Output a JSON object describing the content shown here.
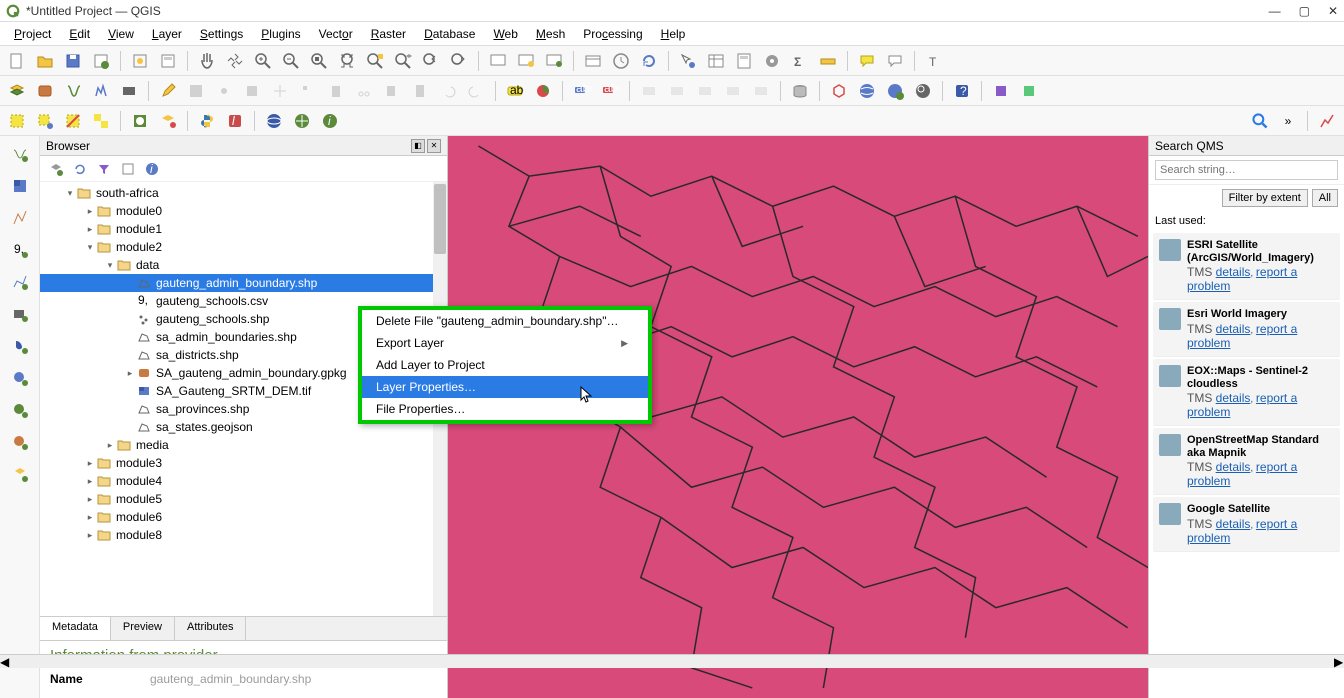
{
  "window": {
    "title": "*Untitled Project — QGIS"
  },
  "menu": [
    "Project",
    "Edit",
    "View",
    "Layer",
    "Settings",
    "Plugins",
    "Vector",
    "Raster",
    "Database",
    "Web",
    "Mesh",
    "Processing",
    "Help"
  ],
  "browser": {
    "title": "Browser",
    "tree": {
      "root": "south-africa",
      "children": [
        {
          "name": "module0",
          "type": "folder"
        },
        {
          "name": "module1",
          "type": "folder"
        },
        {
          "name": "module2",
          "type": "folder",
          "expanded": true,
          "children": [
            {
              "name": "data",
              "type": "folder",
              "expanded": true,
              "children": [
                {
                  "name": "gauteng_admin_boundary.shp",
                  "type": "poly",
                  "selected": true
                },
                {
                  "name": "gauteng_schools.csv",
                  "type": "csv"
                },
                {
                  "name": "gauteng_schools.shp",
                  "type": "point"
                },
                {
                  "name": "sa_admin_boundaries.shp",
                  "type": "poly"
                },
                {
                  "name": "sa_districts.shp",
                  "type": "poly"
                },
                {
                  "name": "SA_gauteng_admin_boundary.gpkg",
                  "type": "gpkg",
                  "hasChildren": true
                },
                {
                  "name": "SA_Gauteng_SRTM_DEM.tif",
                  "type": "raster"
                },
                {
                  "name": "sa_provinces.shp",
                  "type": "poly"
                },
                {
                  "name": "sa_states.geojson",
                  "type": "poly"
                }
              ]
            },
            {
              "name": "media",
              "type": "folder"
            }
          ]
        },
        {
          "name": "module3",
          "type": "folder"
        },
        {
          "name": "module4",
          "type": "folder"
        },
        {
          "name": "module5",
          "type": "folder"
        },
        {
          "name": "module6",
          "type": "folder"
        },
        {
          "name": "module8",
          "type": "folder"
        }
      ]
    }
  },
  "meta": {
    "tabs": [
      "Metadata",
      "Preview",
      "Attributes"
    ],
    "heading": "Information from provider",
    "name_label": "Name",
    "name_value": "gauteng_admin_boundary.shp"
  },
  "context_menu": {
    "items": [
      {
        "label": "Delete File \"gauteng_admin_boundary.shp\"…"
      },
      {
        "label": "Export Layer",
        "submenu": true
      },
      {
        "label": "Add Layer to Project"
      },
      {
        "label": "Layer Properties…",
        "highlight": true
      },
      {
        "label": "File Properties…"
      }
    ]
  },
  "qms": {
    "title": "Search QMS",
    "placeholder": "Search string…",
    "filter_btn": "Filter by extent",
    "all_btn": "All",
    "last_used": "Last used:",
    "tms_label": "TMS",
    "details": "details",
    "report": "report a problem",
    "items": [
      {
        "title": "ESRI Satellite (ArcGIS/World_Imagery)"
      },
      {
        "title": "Esri World Imagery"
      },
      {
        "title": "EOX::Maps - Sentinel-2 cloudless"
      },
      {
        "title": "OpenStreetMap Standard aka Mapnik"
      },
      {
        "title": "Google Satellite"
      }
    ]
  }
}
